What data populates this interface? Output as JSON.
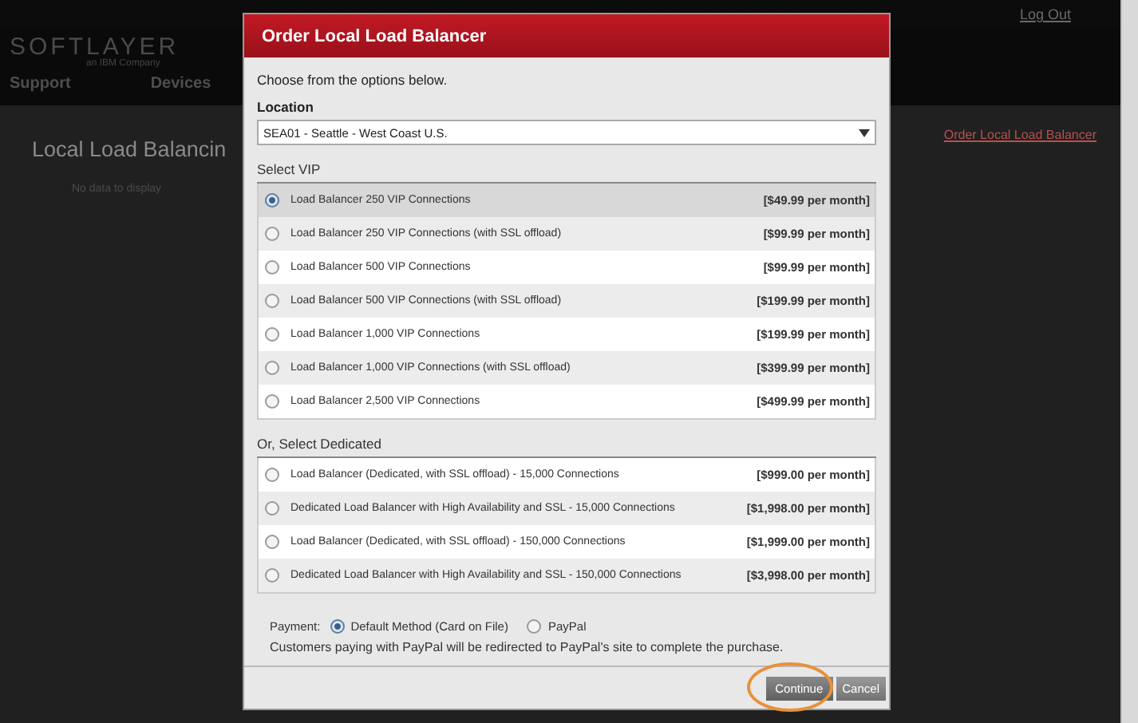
{
  "background": {
    "top_links": [
      "Log Out"
    ],
    "logo": "SOFTLAYER",
    "logo_sub": "an IBM Company",
    "nav": [
      "Support",
      "Devices"
    ],
    "page_title": "Local Load Balancin",
    "empty_text": "No data to display",
    "order_link": "Order Local Load Balancer"
  },
  "modal": {
    "title": "Order Local Load Balancer",
    "intro": "Choose from the options below.",
    "location": {
      "label": "Location",
      "value": "SEA01 - Seattle - West Coast U.S."
    },
    "vip": {
      "heading": "Select VIP",
      "options": [
        {
          "label": "Load Balancer 250 VIP Connections",
          "price": "[$49.99 per month]",
          "selected": true
        },
        {
          "label": "Load Balancer 250 VIP Connections (with SSL offload)",
          "price": "[$99.99 per month]",
          "selected": false
        },
        {
          "label": "Load Balancer 500 VIP Connections",
          "price": "[$99.99 per month]",
          "selected": false
        },
        {
          "label": "Load Balancer 500 VIP Connections (with SSL offload)",
          "price": "[$199.99 per month]",
          "selected": false
        },
        {
          "label": "Load Balancer 1,000 VIP Connections",
          "price": "[$199.99 per month]",
          "selected": false
        },
        {
          "label": "Load Balancer 1,000 VIP Connections (with SSL offload)",
          "price": "[$399.99 per month]",
          "selected": false
        },
        {
          "label": "Load Balancer 2,500 VIP Connections",
          "price": "[$499.99 per month]",
          "selected": false
        }
      ]
    },
    "dedicated": {
      "heading": "Or, Select Dedicated",
      "options": [
        {
          "label": "Load Balancer (Dedicated, with SSL offload) - 15,000 Connections",
          "price": "[$999.00 per month]",
          "selected": false
        },
        {
          "label": "Dedicated Load Balancer with High Availability and SSL - 15,000 Connections",
          "price": "[$1,998.00 per month]",
          "selected": false
        },
        {
          "label": "Load Balancer (Dedicated, with SSL offload) - 150,000 Connections",
          "price": "[$1,999.00 per month]",
          "selected": false
        },
        {
          "label": "Dedicated Load Balancer with High Availability and SSL - 150,000 Connections",
          "price": "[$3,998.00 per month]",
          "selected": false
        }
      ]
    },
    "payment": {
      "label": "Payment:",
      "methods": [
        {
          "label": "Default Method (Card on File)",
          "selected": true
        },
        {
          "label": "PayPal",
          "selected": false
        }
      ],
      "note": "Customers paying with PayPal will be redirected to PayPal's site to complete the purchase."
    },
    "buttons": [
      {
        "label": "Continue",
        "kind": "primary",
        "highlighted": true
      },
      {
        "label": "Cancel",
        "kind": "secondary",
        "highlighted": false
      }
    ]
  }
}
